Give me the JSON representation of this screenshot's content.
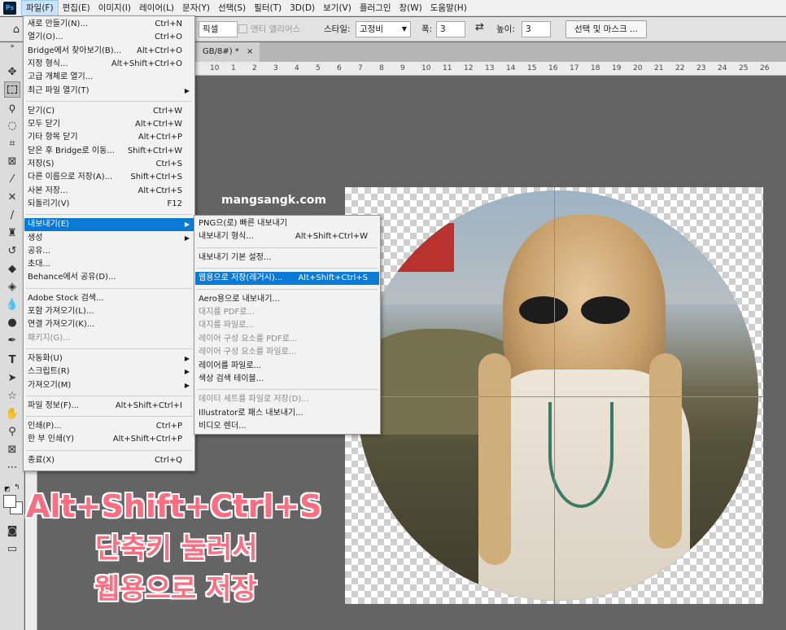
{
  "menubar": [
    {
      "label": "파일(F)",
      "active": true
    },
    {
      "label": "편집(E)"
    },
    {
      "label": "이미지(I)"
    },
    {
      "label": "레이어(L)"
    },
    {
      "label": "문자(Y)"
    },
    {
      "label": "선택(S)"
    },
    {
      "label": "필터(T)"
    },
    {
      "label": "3D(D)"
    },
    {
      "label": "보기(V)"
    },
    {
      "label": "플러그인"
    },
    {
      "label": "창(W)"
    },
    {
      "label": "도움말(H)"
    }
  ],
  "options_bar": {
    "feather_suffix": "픽셀",
    "antialias_label": "앤티 앨리어스",
    "style_label": "스타일:",
    "style_value": "고정비",
    "width_label": "폭:",
    "width_value": "3",
    "height_label": "높이:",
    "height_value": "3",
    "select_mask_button": "선택 및 마스크 ..."
  },
  "doc_tab": {
    "label": "GB/8#) *",
    "close": "×"
  },
  "ruler_numbers": [
    "10",
    "1",
    "2",
    "3",
    "4",
    "5",
    "6",
    "7",
    "8",
    "9",
    "10",
    "11",
    "12",
    "13",
    "14",
    "15",
    "16",
    "17",
    "18",
    "19",
    "20",
    "21",
    "22",
    "23",
    "24",
    "25",
    "26"
  ],
  "watermark": "mangsangk.com",
  "file_menu": [
    {
      "label": "새로 만들기(N)...",
      "shortcut": "Ctrl+N"
    },
    {
      "label": "열기(O)...",
      "shortcut": "Ctrl+O"
    },
    {
      "label": "Bridge에서 찾아보기(B)...",
      "shortcut": "Alt+Ctrl+O"
    },
    {
      "label": "지정 형식...",
      "shortcut": "Alt+Shift+Ctrl+O"
    },
    {
      "label": "고급 개체로 열기..."
    },
    {
      "label": "최근 파일 열기(T)",
      "submenu": true
    },
    {
      "sep": true
    },
    {
      "label": "닫기(C)",
      "shortcut": "Ctrl+W"
    },
    {
      "label": "모두 닫기",
      "shortcut": "Alt+Ctrl+W"
    },
    {
      "label": "기타 항목 닫기",
      "shortcut": "Alt+Ctrl+P"
    },
    {
      "label": "닫은 후 Bridge로 이동...",
      "shortcut": "Shift+Ctrl+W"
    },
    {
      "label": "저장(S)",
      "shortcut": "Ctrl+S"
    },
    {
      "label": "다른 이름으로 저장(A)...",
      "shortcut": "Shift+Ctrl+S"
    },
    {
      "label": "사본 저장...",
      "shortcut": "Alt+Ctrl+S"
    },
    {
      "label": "되돌리기(V)",
      "shortcut": "F12"
    },
    {
      "sep": true
    },
    {
      "label": "내보내기(E)",
      "submenu": true,
      "highlighted": true
    },
    {
      "label": "생성",
      "submenu": true
    },
    {
      "label": "공유..."
    },
    {
      "label": "초대..."
    },
    {
      "label": "Behance에서 공유(D)..."
    },
    {
      "sep": true
    },
    {
      "label": "Adobe Stock 검색..."
    },
    {
      "label": "포함 가져오기(L)..."
    },
    {
      "label": "연결 가져오기(K)..."
    },
    {
      "label": "패키지(G)...",
      "disabled": true
    },
    {
      "sep": true
    },
    {
      "label": "자동화(U)",
      "submenu": true
    },
    {
      "label": "스크립트(R)",
      "submenu": true
    },
    {
      "label": "가져오기(M)",
      "submenu": true
    },
    {
      "sep": true
    },
    {
      "label": "파일 정보(F)...",
      "shortcut": "Alt+Shift+Ctrl+I"
    },
    {
      "sep": true
    },
    {
      "label": "인쇄(P)...",
      "shortcut": "Ctrl+P"
    },
    {
      "label": "한 부 인쇄(Y)",
      "shortcut": "Alt+Shift+Ctrl+P"
    },
    {
      "sep": true
    },
    {
      "label": "종료(X)",
      "shortcut": "Ctrl+Q"
    }
  ],
  "export_menu": [
    {
      "label": "PNG으(로) 빠른 내보내기"
    },
    {
      "label": "내보내기 형식...",
      "shortcut": "Alt+Shift+Ctrl+W"
    },
    {
      "sep": true
    },
    {
      "label": "내보내기 기본 설정..."
    },
    {
      "sep": true
    },
    {
      "label": "웹용으로 저장(레거시)...",
      "shortcut": "Alt+Shift+Ctrl+S",
      "highlighted": true
    },
    {
      "sep": true
    },
    {
      "label": "Aero용으로 내보내기..."
    },
    {
      "label": "대지를 PDF로...",
      "disabled": true
    },
    {
      "label": "대지를 파일로...",
      "disabled": true
    },
    {
      "label": "레이어 구성 요소를 PDF로...",
      "disabled": true
    },
    {
      "label": "레이어 구성 요소를 파일로...",
      "disabled": true
    },
    {
      "label": "레이어를 파일로..."
    },
    {
      "label": "색상 검색 테이블..."
    },
    {
      "sep": true
    },
    {
      "label": "데이터 세트를 파일로 저장(D)...",
      "disabled": true
    },
    {
      "label": "Illustrator로 패스 내보내기..."
    },
    {
      "label": "비디오 렌더..."
    }
  ],
  "caption": {
    "line1": "Alt+Shift+Ctrl+S",
    "line2": "단축키 눌러서",
    "line3": "웹용으로 저장"
  }
}
